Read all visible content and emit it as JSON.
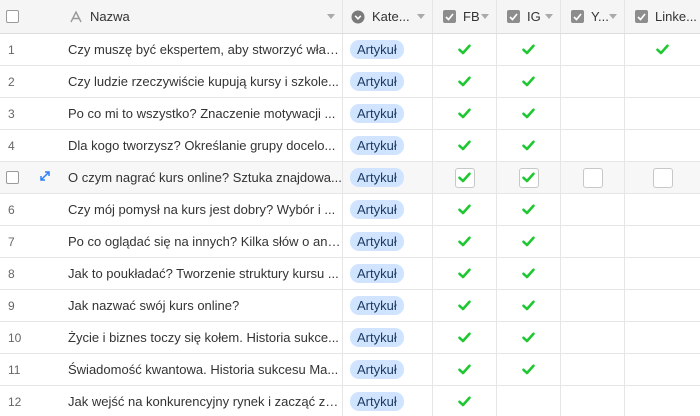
{
  "columns": {
    "name": "Nazwa",
    "kategoria": "Kate...",
    "fb": "FB",
    "ig": "IG",
    "yt": "Y...",
    "li": "Linke..."
  },
  "colors": {
    "check": "#20c933",
    "pill_bg": "#d0e4ff",
    "pill_text": "#1b3a63",
    "header_bg": "#f5f5f5"
  },
  "icons": {
    "name_col": "text-A-icon",
    "kategoria_col": "single-select-icon",
    "checkbox_cols": "checkbox-column-icon",
    "expand": "expand-arrows-icon",
    "check": "green-checkmark-icon"
  },
  "rows": [
    {
      "num": "1",
      "name": "Czy muszę być ekspertem, aby stworzyć włas...",
      "kategoria": "Artykuł",
      "fb": true,
      "ig": true,
      "yt": false,
      "li": true
    },
    {
      "num": "2",
      "name": "Czy ludzie rzeczywiście kupują kursy i szkole...",
      "kategoria": "Artykuł",
      "fb": true,
      "ig": true,
      "yt": false,
      "li": false
    },
    {
      "num": "3",
      "name": "Po co mi to wszystko? Znaczenie motywacji ...",
      "kategoria": "Artykuł",
      "fb": true,
      "ig": true,
      "yt": false,
      "li": false
    },
    {
      "num": "4",
      "name": "Dla kogo tworzysz? Określanie grupy docelo...",
      "kategoria": "Artykuł",
      "fb": true,
      "ig": true,
      "yt": false,
      "li": false
    },
    {
      "num": "",
      "name": "O czym nagrać kurs online? Sztuka znajdowa...",
      "kategoria": "Artykuł",
      "fb": true,
      "ig": true,
      "yt": false,
      "li": false,
      "hover": true
    },
    {
      "num": "6",
      "name": "Czy mój pomysł na kurs jest dobry? Wybór i ...",
      "kategoria": "Artykuł",
      "fb": true,
      "ig": true,
      "yt": false,
      "li": false
    },
    {
      "num": "7",
      "name": "Po co oglądać się na innych? Kilka słów o ana...",
      "kategoria": "Artykuł",
      "fb": true,
      "ig": true,
      "yt": false,
      "li": false
    },
    {
      "num": "8",
      "name": "Jak to poukładać? Tworzenie struktury kursu ...",
      "kategoria": "Artykuł",
      "fb": true,
      "ig": true,
      "yt": false,
      "li": false
    },
    {
      "num": "9",
      "name": "Jak nazwać swój kurs online?",
      "kategoria": "Artykuł",
      "fb": true,
      "ig": true,
      "yt": false,
      "li": false
    },
    {
      "num": "10",
      "name": "Życie i biznes toczy się kołem. Historia sukce...",
      "kategoria": "Artykuł",
      "fb": true,
      "ig": true,
      "yt": false,
      "li": false
    },
    {
      "num": "11",
      "name": "Świadomość kwantowa. Historia sukcesu Ma...",
      "kategoria": "Artykuł",
      "fb": true,
      "ig": true,
      "yt": false,
      "li": false
    },
    {
      "num": "12",
      "name": "Jak wejść na konkurencyjny rynek i zacząć zar...",
      "kategoria": "Artykuł",
      "fb": true,
      "ig": false,
      "yt": false,
      "li": false
    }
  ]
}
